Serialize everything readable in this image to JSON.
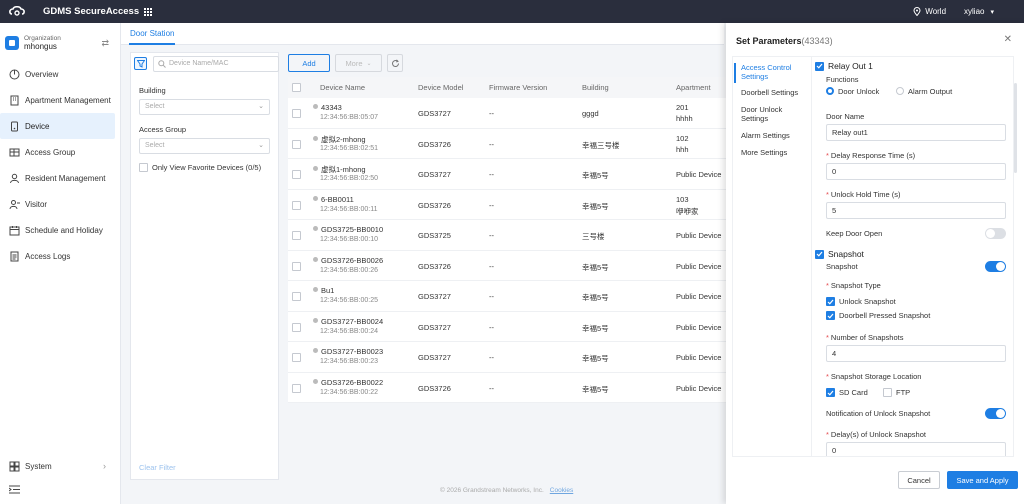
{
  "app": {
    "title": "GDMS SecureAccess",
    "region": "World",
    "user": "xyliao"
  },
  "org": {
    "label": "Organization",
    "name": "mhongus"
  },
  "nav": {
    "items": [
      "Overview",
      "Apartment Management",
      "Device",
      "Access Group",
      "Resident Management",
      "Visitor",
      "Schedule and Holiday",
      "Access Logs"
    ],
    "active": "Device",
    "system": "System"
  },
  "tabs": {
    "active": "Door Station"
  },
  "filter": {
    "search_placeholder": "Device Name/MAC",
    "building_label": "Building",
    "building_placeholder": "Select",
    "access_group_label": "Access Group",
    "access_group_placeholder": "Select",
    "favorite_label": "Only View Favorite Devices (0/5)",
    "clear": "Clear Filter"
  },
  "toolbar": {
    "add": "Add",
    "more": "More"
  },
  "table": {
    "columns": [
      "Device Name",
      "Device Model",
      "Firmware Version",
      "Building",
      "Apartment"
    ],
    "rows": [
      {
        "name": "43343",
        "mac": "12:34:56:BB:05:07",
        "model": "GDS3727",
        "fw": "--",
        "building": "gggd",
        "apt": "201",
        "apt2": "hhhh"
      },
      {
        "name": "虚拟2-mhong",
        "mac": "12:34:56:BB:02:51",
        "model": "GDS3726",
        "fw": "--",
        "building": "幸福三号楼",
        "apt": "102",
        "apt2": "hhh"
      },
      {
        "name": "虚拟1-mhong",
        "mac": "12:34:56:BB:02:50",
        "model": "GDS3727",
        "fw": "--",
        "building": "幸福5号",
        "apt": "Public Device",
        "apt2": ""
      },
      {
        "name": "6-BB0011",
        "mac": "12:34:56:BB:00:11",
        "model": "GDS3726",
        "fw": "--",
        "building": "幸福5号",
        "apt": "103",
        "apt2": "咿咿家"
      },
      {
        "name": "GDS3725-BB0010",
        "mac": "12:34:56:BB:00:10",
        "model": "GDS3725",
        "fw": "--",
        "building": "三号楼",
        "apt": "Public Device",
        "apt2": ""
      },
      {
        "name": "GDS3726-BB0026",
        "mac": "12:34:56:BB:00:26",
        "model": "GDS3726",
        "fw": "--",
        "building": "幸福5号",
        "apt": "Public Device",
        "apt2": ""
      },
      {
        "name": "Bu1",
        "mac": "12:34:56:BB:00:25",
        "model": "GDS3727",
        "fw": "--",
        "building": "幸福5号",
        "apt": "Public Device",
        "apt2": ""
      },
      {
        "name": "GDS3727-BB0024",
        "mac": "12:34:56:BB:00:24",
        "model": "GDS3727",
        "fw": "--",
        "building": "幸福5号",
        "apt": "Public Device",
        "apt2": ""
      },
      {
        "name": "GDS3727-BB0023",
        "mac": "12:34:56:BB:00:23",
        "model": "GDS3727",
        "fw": "--",
        "building": "幸福5号",
        "apt": "Public Device",
        "apt2": ""
      },
      {
        "name": "GDS3726-BB0022",
        "mac": "12:34:56:BB:00:22",
        "model": "GDS3726",
        "fw": "--",
        "building": "幸福5号",
        "apt": "Public Device",
        "apt2": ""
      }
    ]
  },
  "footer": {
    "copyright": "© 2026 Grandstream Networks, Inc.",
    "cookies": "Cookies"
  },
  "panel": {
    "title": "Set Parameters",
    "id": "(43343)",
    "nav": [
      "Access Control Settings",
      "Doorbell Settings",
      "Door Unlock Settings",
      "Alarm Settings",
      "More Settings"
    ],
    "relay_out": "Relay Out 1",
    "functions_label": "Functions",
    "door_unlock": "Door Unlock",
    "alarm_output": "Alarm Output",
    "door_name_label": "Door Name",
    "door_name": "Relay out1",
    "delay_label": "Delay Response Time (s)",
    "delay_value": "0",
    "hold_label": "Unlock Hold Time (s)",
    "hold_value": "5",
    "keep_open_label": "Keep Door Open",
    "keep_open": false,
    "snapshot_header": "Snapshot",
    "snapshot_label": "Snapshot",
    "snapshot_on": true,
    "snapshot_type_label": "Snapshot Type",
    "unlock_snapshot": "Unlock Snapshot",
    "doorbell_snapshot": "Doorbell Pressed Snapshot",
    "num_label": "Number of Snapshots",
    "num_value": "4",
    "storage_label": "Snapshot Storage Location",
    "sd_card": "SD Card",
    "ftp": "FTP",
    "notify_label": "Notification of Unlock Snapshot",
    "notify_on": true,
    "delay_snap_label": "Delay(s) of Unlock Snapshot",
    "delay_snap_value": "0",
    "cancel": "Cancel",
    "save": "Save and Apply"
  },
  "colors": {
    "accent": "#1e7ee3",
    "topbar": "#2a2e3d"
  }
}
